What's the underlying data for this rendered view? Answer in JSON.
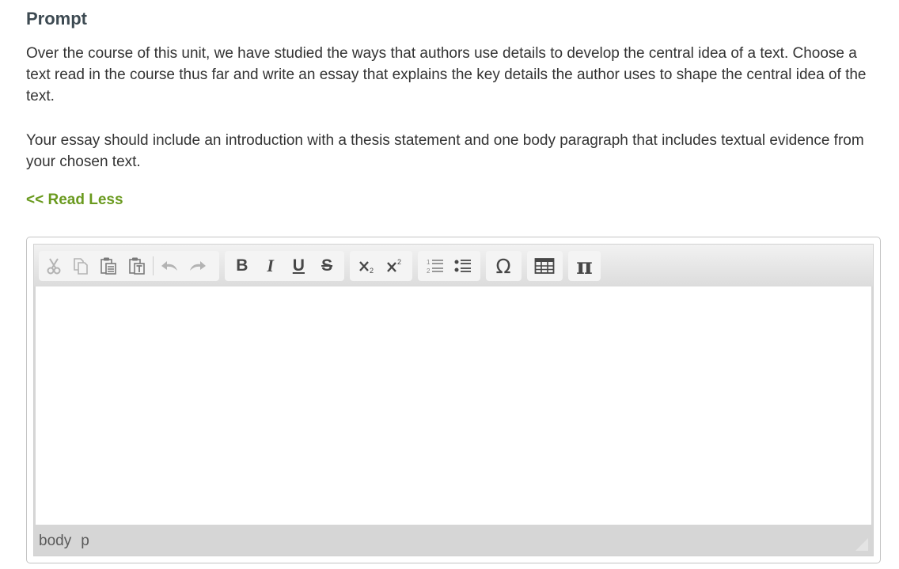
{
  "prompt": {
    "heading": "Prompt",
    "paragraph_1": "Over the course of this unit, we have studied the ways that authors use details to develop the central idea of a text. Choose a text read in the course thus far and write an essay that explains the key details the author uses to shape the central idea of the text.",
    "paragraph_2": "Your essay should include an introduction with a thesis statement and one body paragraph that includes textual evidence from your chosen text.",
    "read_less": "<< Read Less"
  },
  "editor": {
    "toolbar": {
      "clipboard": [
        "cut-icon",
        "copy-icon",
        "paste-icon",
        "paste-text-icon"
      ],
      "history": [
        "undo-icon",
        "redo-icon"
      ],
      "format": {
        "bold": "B",
        "italic": "I",
        "underline": "U",
        "strike": "S"
      },
      "script": [
        "subscript-icon",
        "superscript-icon"
      ],
      "lists": [
        "numbered-list-icon",
        "bulleted-list-icon"
      ],
      "special_char": "Ω",
      "table": "table-icon",
      "math": "π"
    },
    "content": "",
    "path": [
      "body",
      "p"
    ]
  }
}
